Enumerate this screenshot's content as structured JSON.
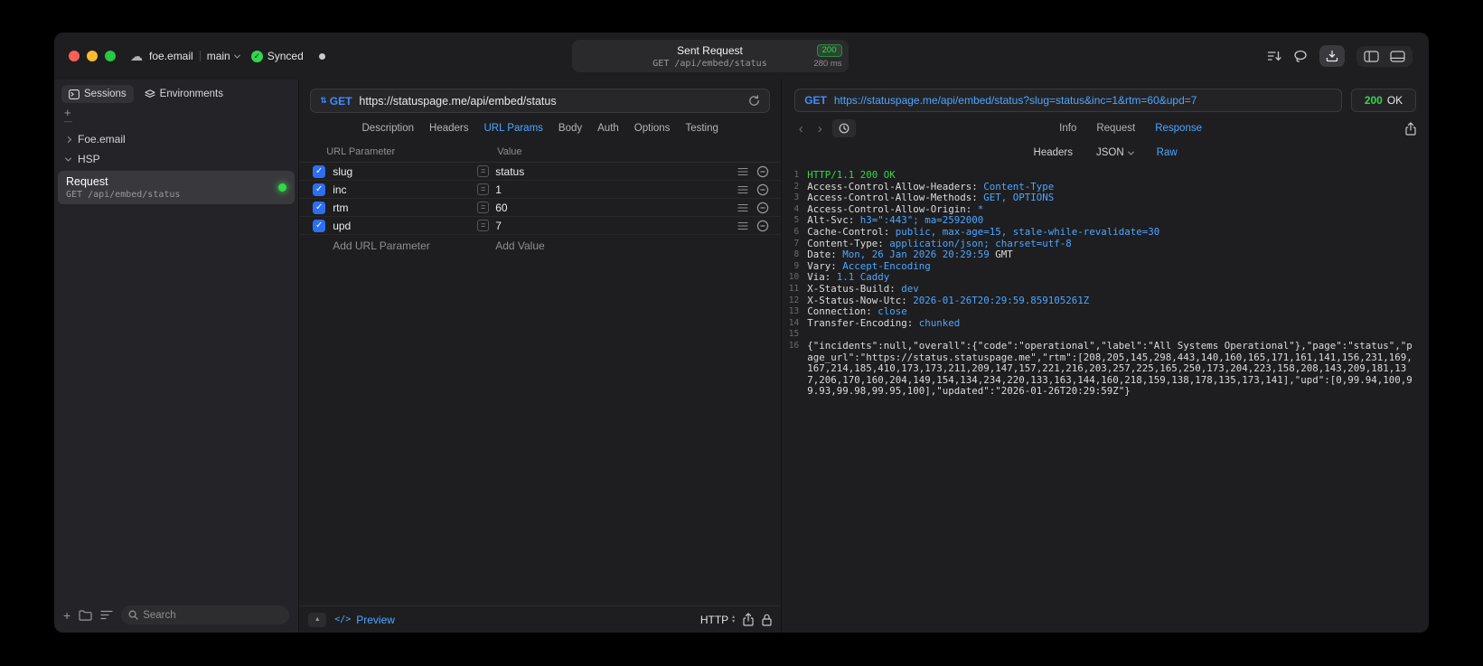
{
  "colors": {
    "accent_blue": "#4da6ff",
    "method_blue": "#3f8cff",
    "status_green": "#32d74b",
    "checkbox_blue": "#2d6ff0"
  },
  "icons": {
    "cloud": "☁",
    "check": "✓",
    "plus": "+",
    "dash": "—",
    "updown": "⇅",
    "back": "‹",
    "forward": "›",
    "preview_code": "</>",
    "collapse": "▲",
    "equals": "=",
    "select_up": "▴",
    "select_down": "▾"
  },
  "window": {
    "project": "foe.email",
    "branch": "main",
    "sync_label": "Synced",
    "header_title": "Sent Request",
    "header_status": "200",
    "header_subtitle": "GET /api/embed/status",
    "header_time": "280 ms"
  },
  "sidebar": {
    "tabs": [
      {
        "label": "Sessions"
      },
      {
        "label": "Environments"
      }
    ],
    "groups": [
      {
        "label": "Foe.email"
      },
      {
        "label": "HSP"
      }
    ],
    "request_item": {
      "title": "Request",
      "subtitle": "GET /api/embed/status"
    },
    "search_placeholder": "Search"
  },
  "request_pane": {
    "method": "GET",
    "url": "https://statuspage.me/api/embed/status",
    "tabs": [
      "Description",
      "Headers",
      "URL Params",
      "Body",
      "Auth",
      "Options",
      "Testing"
    ],
    "active_tab": "URL Params",
    "params": {
      "col_name": "URL Parameter",
      "col_value": "Value",
      "rows": [
        {
          "name": "slug",
          "value": "status",
          "enabled": true
        },
        {
          "name": "inc",
          "value": "1",
          "enabled": true
        },
        {
          "name": "rtm",
          "value": "60",
          "enabled": true
        },
        {
          "name": "upd",
          "value": "7",
          "enabled": true
        }
      ],
      "add_name": "Add URL Parameter",
      "add_value": "Add Value"
    },
    "footer": {
      "preview_label": "Preview",
      "http_label": "HTTP"
    }
  },
  "response_pane": {
    "method": "GET",
    "url": "https://statuspage.me/api/embed/status?slug=status&inc=1&rtm=60&upd=7",
    "status_code": "200",
    "status_text": "OK",
    "tabs": [
      "Info",
      "Request",
      "Response"
    ],
    "active_tab": "Response",
    "subtabs": [
      "Headers",
      "JSON",
      "Raw"
    ],
    "active_subtab": "Raw",
    "lines": [
      {
        "n": "1",
        "segments": [
          {
            "t": "HTTP/1.1 200 OK",
            "c": "green"
          }
        ]
      },
      {
        "n": "2",
        "segments": [
          {
            "t": "Access-Control-Allow-Headers: ",
            "c": "plain"
          },
          {
            "t": "Content-Type",
            "c": "blue"
          }
        ]
      },
      {
        "n": "3",
        "segments": [
          {
            "t": "Access-Control-Allow-Methods: ",
            "c": "plain"
          },
          {
            "t": "GET, OPTIONS",
            "c": "blue"
          }
        ]
      },
      {
        "n": "4",
        "segments": [
          {
            "t": "Access-Control-Allow-Origin: ",
            "c": "plain"
          },
          {
            "t": "*",
            "c": "blue"
          }
        ]
      },
      {
        "n": "5",
        "segments": [
          {
            "t": "Alt-Svc: ",
            "c": "plain"
          },
          {
            "t": "h3=\":443\"; ma=2592000",
            "c": "blue"
          }
        ]
      },
      {
        "n": "6",
        "segments": [
          {
            "t": "Cache-Control: ",
            "c": "plain"
          },
          {
            "t": "public, max-age=15, stale-while-revalidate=30",
            "c": "blue"
          }
        ]
      },
      {
        "n": "7",
        "segments": [
          {
            "t": "Content-Type: ",
            "c": "plain"
          },
          {
            "t": "application/json; charset=utf-8",
            "c": "blue"
          }
        ]
      },
      {
        "n": "8",
        "segments": [
          {
            "t": "Date: ",
            "c": "plain"
          },
          {
            "t": "Mon, 26 Jan 2026 20:29:59",
            "c": "blue"
          },
          {
            "t": " GMT",
            "c": "plain"
          }
        ]
      },
      {
        "n": "9",
        "segments": [
          {
            "t": "Vary: ",
            "c": "plain"
          },
          {
            "t": "Accept-Encoding",
            "c": "blue"
          }
        ]
      },
      {
        "n": "10",
        "segments": [
          {
            "t": "Via: ",
            "c": "plain"
          },
          {
            "t": "1.1 Caddy",
            "c": "blue"
          }
        ]
      },
      {
        "n": "11",
        "segments": [
          {
            "t": "X-Status-Build: ",
            "c": "plain"
          },
          {
            "t": "dev",
            "c": "blue"
          }
        ]
      },
      {
        "n": "12",
        "segments": [
          {
            "t": "X-Status-Now-Utc: ",
            "c": "plain"
          },
          {
            "t": "2026-01-26T20:29:59.859105261Z",
            "c": "blue"
          }
        ]
      },
      {
        "n": "13",
        "segments": [
          {
            "t": "Connection: ",
            "c": "plain"
          },
          {
            "t": "close",
            "c": "blue"
          }
        ]
      },
      {
        "n": "14",
        "segments": [
          {
            "t": "Transfer-Encoding: ",
            "c": "plain"
          },
          {
            "t": "chunked",
            "c": "blue"
          }
        ]
      },
      {
        "n": "15",
        "segments": []
      },
      {
        "n": "16",
        "segments": [
          {
            "t": "{\"incidents\":null,\"overall\":{\"code\":\"operational\",\"label\":\"All Systems Operational\"},\"page\":\"status\",\"page_url\":\"https://status.statuspage.me\",\"rtm\":[208,205,145,298,443,140,160,165,171,161,141,156,231,169,167,214,185,410,173,173,211,209,147,157,221,216,203,257,225,165,250,173,204,223,158,208,143,209,181,137,206,170,160,204,149,154,134,234,220,133,163,144,160,218,159,138,178,135,173,141],\"upd\":[0,99.94,100,99.93,99.98,99.95,100],\"updated\":\"2026-01-26T20:29:59Z\"}",
            "c": "plain"
          }
        ]
      }
    ]
  }
}
